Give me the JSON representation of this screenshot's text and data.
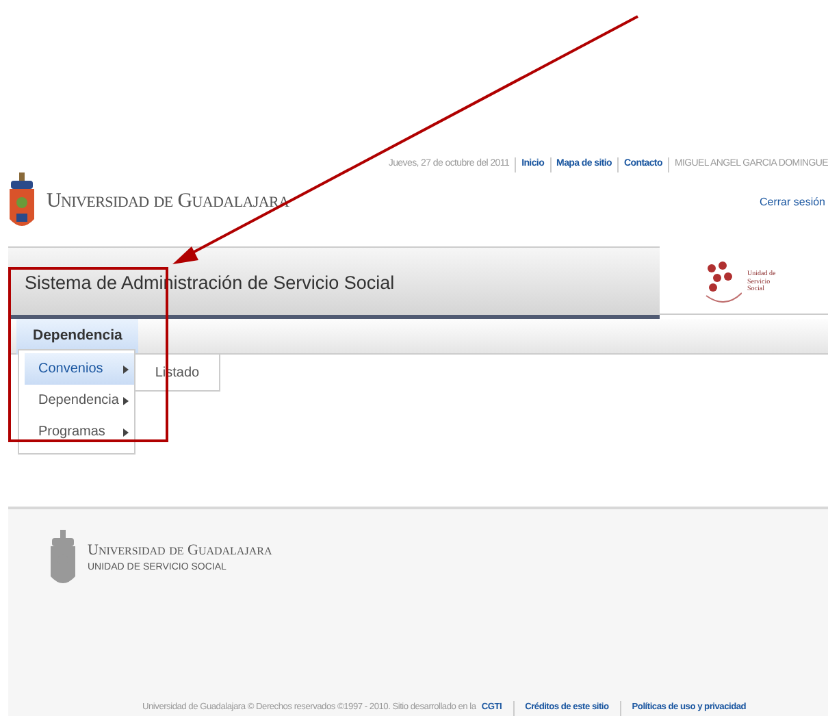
{
  "header": {
    "logo_text": "Universidad de Guadalajara",
    "date": "Jueves, 27 de octubre del 2011",
    "links": [
      "Inicio",
      "Mapa de sitio",
      "Contacto"
    ],
    "user": "MIGUEL ANGEL GARCIA DOMINGUE",
    "logout": "Cerrar sesión"
  },
  "title_bar": {
    "title": "Sistema de Administración de Servicio Social",
    "logo_text": "Unidad de Servicio Social"
  },
  "menu": [
    {
      "label": "Dependencia",
      "selected": true,
      "children": [
        {
          "label": "Convenios",
          "selected": true,
          "children": [
            {
              "label": "Listado",
              "selected": false
            }
          ]
        },
        {
          "label": "Dependencia",
          "selected": false
        },
        {
          "label": "Programas",
          "selected": false
        }
      ]
    }
  ],
  "footer": {
    "logo_text": "Universidad de Guadalajara",
    "subtitle": "UNIDAD DE SERVICIO SOCIAL",
    "copyright": "Universidad de Guadalajara © Derechos reservados ©1997 - 2010. Sitio desarrollado en la",
    "links": [
      "CGTI",
      "Créditos de este sitio",
      "Políticas de uso y privacidad"
    ]
  }
}
